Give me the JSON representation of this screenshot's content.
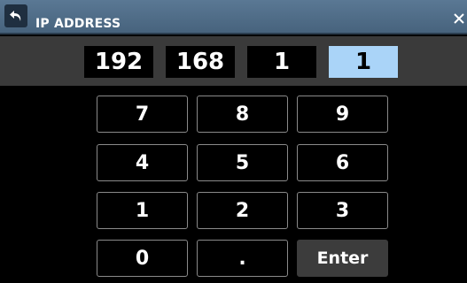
{
  "header": {
    "title": "IP ADDRESS",
    "back_icon": "back-arrow-icon",
    "close_icon": "close-icon"
  },
  "address": {
    "octets": [
      "192",
      "168",
      "1",
      "1"
    ],
    "selected_index": 3
  },
  "keypad": {
    "k7": "7",
    "k8": "8",
    "k9": "9",
    "k4": "4",
    "k5": "5",
    "k6": "6",
    "k1": "1",
    "k2": "2",
    "k3": "3",
    "k0": "0",
    "dot": ".",
    "enter": "Enter"
  },
  "colors": {
    "title_bar": "#4f6c88",
    "selected_octet": "#aad4f8",
    "enter_key": "#3c3c3c"
  }
}
